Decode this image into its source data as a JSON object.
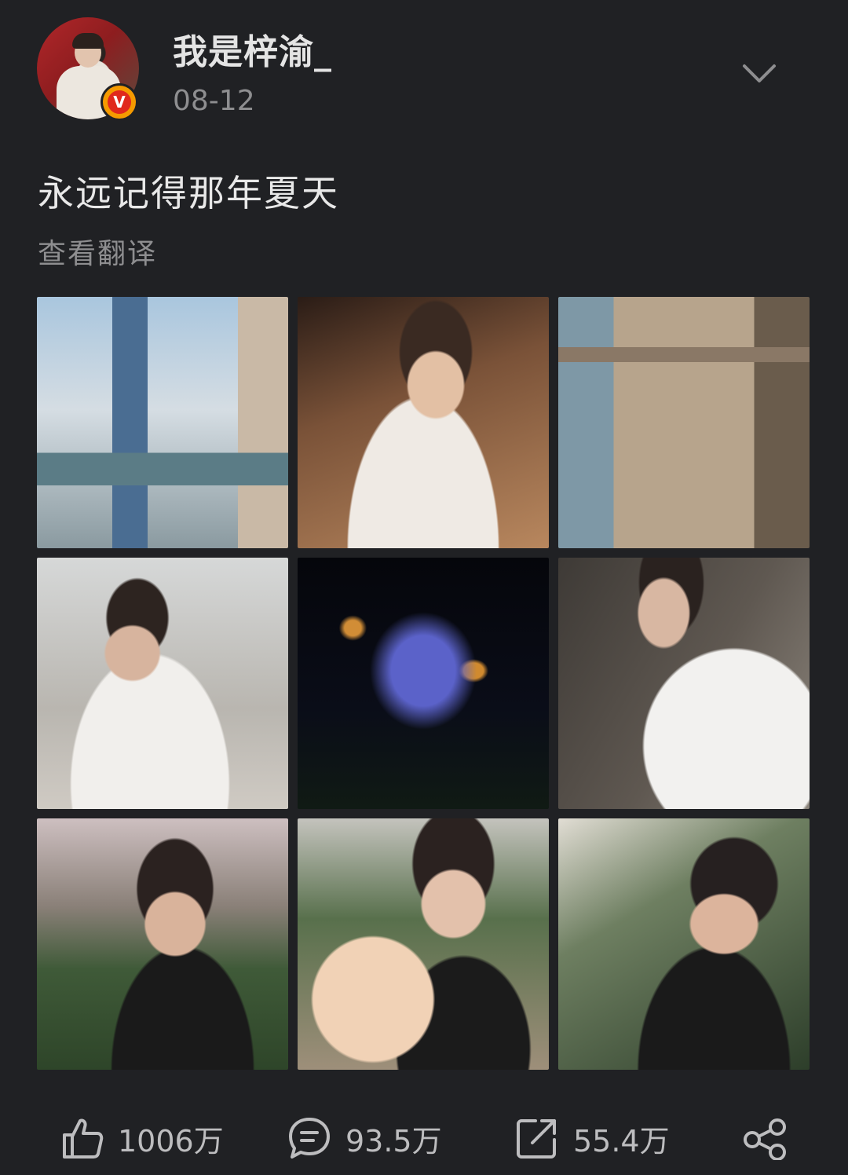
{
  "post": {
    "author": {
      "name": "我是梓渝_",
      "verified_badge_letter": "V"
    },
    "date": "08-12",
    "text": "永远记得那年夏天",
    "translate_label": "查看翻译",
    "photos_count_shown": 9
  },
  "actions": {
    "likes": "1006万",
    "comments": "93.5万",
    "reposts": "55.4万"
  },
  "colors": {
    "background": "#202124",
    "primary_text": "#e8e8e8",
    "secondary_text": "#8e8e90",
    "verified_badge": "#f59a00"
  },
  "icons": [
    "chevron-down-icon",
    "like-icon",
    "comment-icon",
    "repost-icon",
    "share-icon"
  ]
}
